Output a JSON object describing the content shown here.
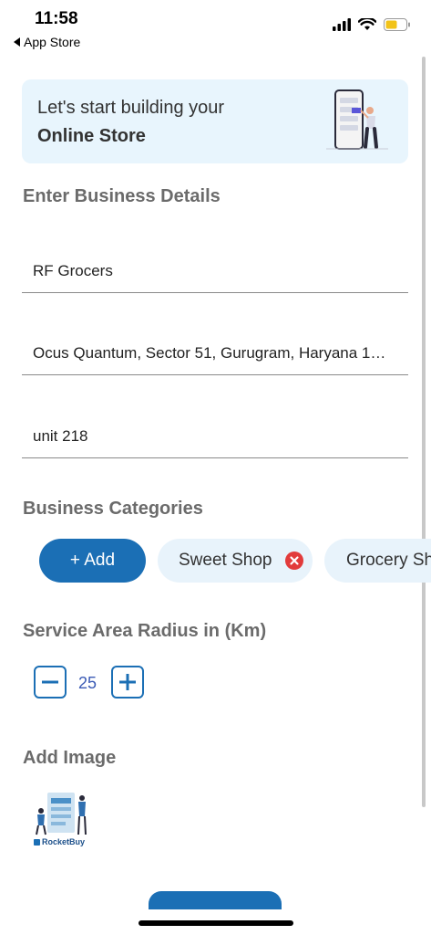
{
  "status_bar": {
    "time": "11:58",
    "back_app_label": "App Store",
    "icons": [
      "signal-icon",
      "wifi-icon",
      "battery-icon"
    ]
  },
  "banner": {
    "line1": "Let's start building your",
    "line2": "Online Store"
  },
  "business_details": {
    "title": "Enter Business Details",
    "business_name": "RF Grocers",
    "address": "Ocus Quantum, Sector 51, Gurugram, Haryana 1…",
    "unit": "unit 218"
  },
  "categories": {
    "title": "Business Categories",
    "add_label": "+ Add",
    "items": [
      "Sweet Shop",
      "Grocery Sh"
    ]
  },
  "service_area": {
    "title": "Service Area Radius in (Km)",
    "value": "25"
  },
  "add_image": {
    "title": "Add Image",
    "thumb_brand": "RocketBuy"
  },
  "colors": {
    "accent": "#1b6fb5",
    "banner_bg": "#e8f5fd",
    "chip_bg": "#e8f3fb",
    "remove": "#e23b3b"
  }
}
